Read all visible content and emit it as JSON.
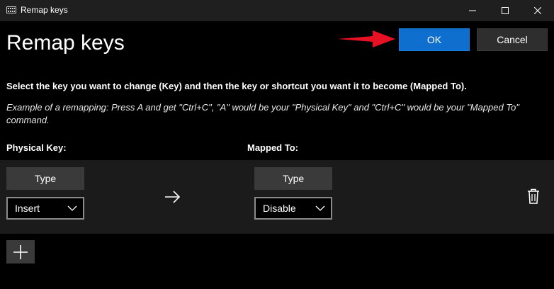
{
  "window": {
    "title": "Remap keys",
    "app_icon": "keyboard-icon",
    "controls": [
      "minimize-icon",
      "maximize-icon",
      "close-icon"
    ]
  },
  "header": {
    "title": "Remap keys",
    "ok_label": "OK",
    "cancel_label": "Cancel"
  },
  "instructions": {
    "main": "Select the key you want to change (Key) and then the key or shortcut you want it to become (Mapped To).",
    "example": "Example of a remapping: Press A and get \"Ctrl+C\", \"A\" would be your \"Physical Key\" and \"Ctrl+C\" would be your \"Mapped To\" command."
  },
  "columns": {
    "physical": "Physical Key:",
    "mapped": "Mapped To:"
  },
  "mappings": [
    {
      "physical_type_label": "Type",
      "physical_value": "Insert",
      "mapped_type_label": "Type",
      "mapped_value": "Disable"
    }
  ],
  "icons": {
    "mapping_arrow": "arrow-right-icon",
    "delete": "trash-icon",
    "add": "plus-icon",
    "dropdown": "chevron-down-icon",
    "annotation": "red-pointer-arrow-icon"
  },
  "colors": {
    "accent": "#0f6fcf",
    "background": "#000000",
    "row_background": "#1b1b1b",
    "button": "#3a3a3a",
    "annotation": "#e81123"
  }
}
